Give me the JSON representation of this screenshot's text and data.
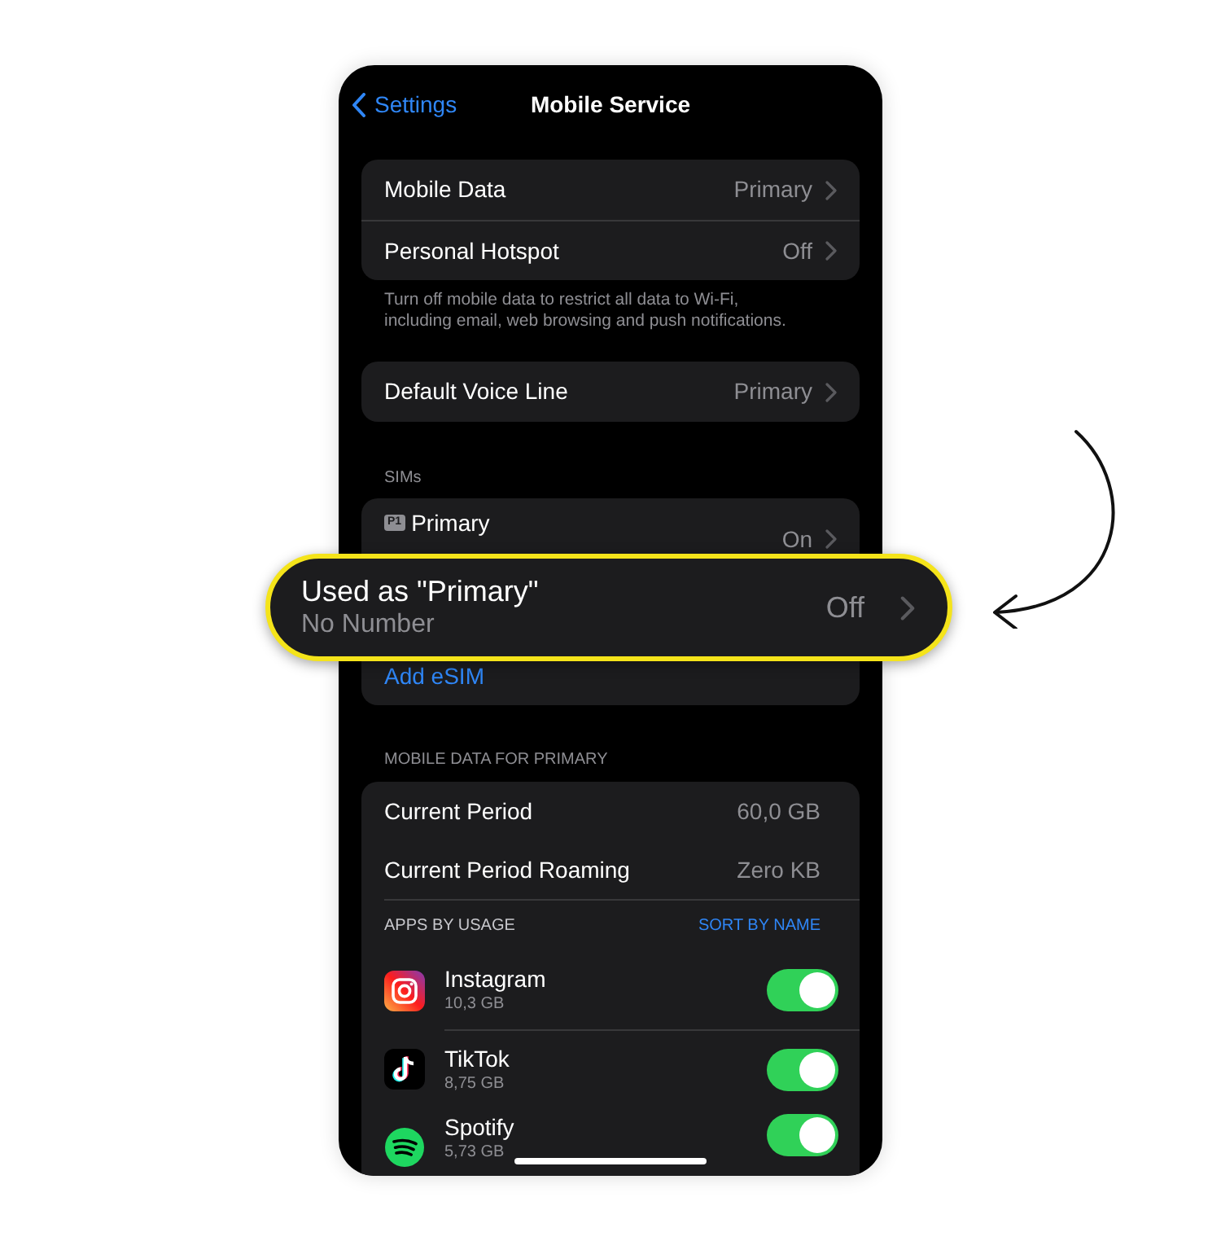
{
  "nav": {
    "back": "Settings",
    "title": "Mobile Service"
  },
  "mobile_data_group": {
    "rows": [
      {
        "label": "Mobile Data",
        "value": "Primary"
      },
      {
        "label": "Personal Hotspot",
        "value": "Off"
      }
    ],
    "footer": "Turn off mobile data to restrict all data to Wi-Fi, including email, web browsing and push notifications."
  },
  "voice_group": {
    "rows": [
      {
        "label": "Default Voice Line",
        "value": "Primary"
      }
    ]
  },
  "sims": {
    "header": "SIMs",
    "primary": {
      "badge": "P1",
      "label": "Primary",
      "value": "On"
    },
    "add_esim": "Add eSIM"
  },
  "callout": {
    "title": "Used as \"Primary\"",
    "subtitle": "No Number",
    "value": "Off"
  },
  "usage": {
    "header": "MOBILE DATA FOR PRIMARY",
    "rows": [
      {
        "label": "Current Period",
        "value": "60,0 GB"
      },
      {
        "label": "Current Period Roaming",
        "value": "Zero KB"
      }
    ],
    "apps_header": "APPS BY USAGE",
    "sort": "SORT BY NAME",
    "apps": [
      {
        "name": "Instagram",
        "size": "10,3 GB",
        "on": true
      },
      {
        "name": "TikTok",
        "size": "8,75 GB",
        "on": true
      },
      {
        "name": "Spotify",
        "size": "5,73 GB",
        "on": true
      }
    ]
  }
}
